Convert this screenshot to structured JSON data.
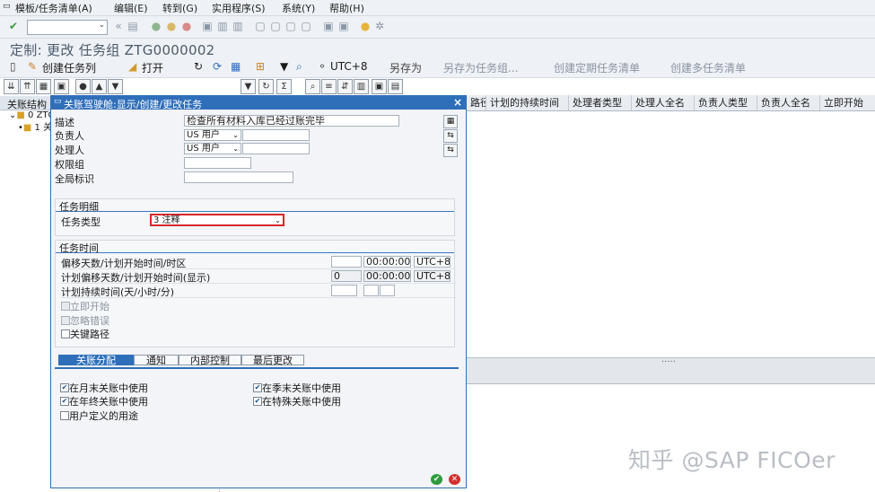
{
  "menubar": {
    "items": [
      "模板/任务清单(A)",
      "编辑(E)",
      "转到(G)",
      "实用程序(S)",
      "系统(Y)",
      "帮助(H)"
    ]
  },
  "page": {
    "title": "定制:   更改 任务组 ZTG0000002"
  },
  "toolbar2": {
    "create_task_list": "创建任务列",
    "open": "打开",
    "utc": "UTC+8",
    "save_as": "另存为",
    "save_as_task_group": "另存为任务组...",
    "create_periodic": "创建定期任务清单",
    "create_multi": "创建多任务清单"
  },
  "tree": {
    "header": "关账结构",
    "node0": "0 ZTG",
    "node1": "1 关"
  },
  "grid": {
    "columns": [
      "路径",
      "计划的持续时间",
      "处理者类型",
      "处理人全名",
      "负责人类型",
      "负责人全名",
      "立即开始"
    ]
  },
  "dialog": {
    "title": "关账驾驶舱:显示/创建/更改任务",
    "fields": {
      "description_label": "描述",
      "description_value": "检查所有材料入库已经过账完毕",
      "responsible_label": "负责人",
      "responsible_type": "US 用户",
      "processor_label": "处理人",
      "processor_type": "US 用户",
      "auth_group_label": "权限组",
      "global_id_label": "全局标识"
    },
    "task_details": {
      "header": "任务明细",
      "task_type_label": "任务类型",
      "task_type_value": "3 注释"
    },
    "task_time": {
      "header": "任务时间",
      "offset_label": "偏移天数/计划开始时间/时区",
      "offset_time": "00:00:00",
      "offset_tz": "UTC+8",
      "planned_label": "计划偏移天数/计划开始时间(显示)",
      "planned_days": "0",
      "planned_time": "00:00:00",
      "planned_tz": "UTC+8",
      "duration_label": "计划持续时间(天/小时/分)",
      "start_immediately": "立即开始",
      "ignore_errors": "忽略错误",
      "critical_path": "关键路径",
      "start_immediately_checked": false,
      "ignore_errors_checked": false,
      "critical_path_checked": false
    },
    "tabs": [
      "关账分配",
      "通知",
      "内部控制",
      "最后更改"
    ],
    "close_usage": {
      "month_end": "在月末关账中使用",
      "quarter_end": "在季末关账中使用",
      "year_end": "在年终关账中使用",
      "special": "在特殊关账中使用",
      "user_defined": "用户定义的用途",
      "month_end_checked": true,
      "quarter_end_checked": true,
      "year_end_checked": true,
      "special_checked": true,
      "user_defined_checked": false
    }
  },
  "watermark": "知乎 @SAP FICOer",
  "colors": {
    "dialog_title": "#2f6fba",
    "highlight": "#d9262a",
    "ok": "#2e9a3c",
    "cancel": "#d22f2f"
  }
}
